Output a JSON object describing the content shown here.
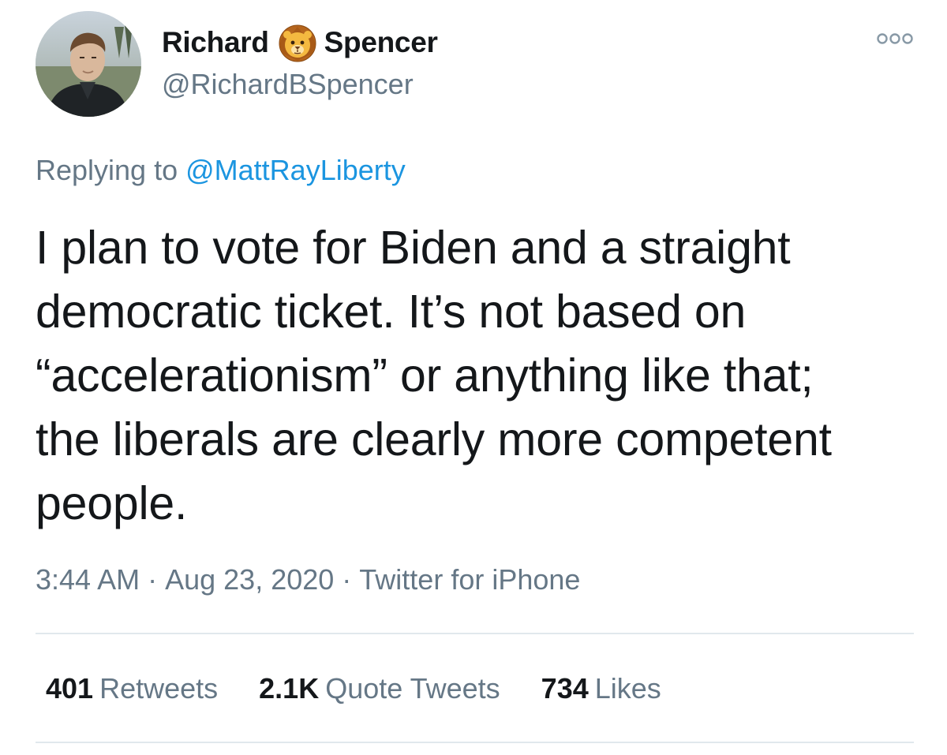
{
  "author": {
    "first_name": "Richard",
    "last_name": "Spencer",
    "name_icon": "lion-face-icon",
    "handle": "@RichardBSpencer",
    "avatar_icon": "profile-photo"
  },
  "menu": {
    "icon": "more-options-icon"
  },
  "reply": {
    "prefix": "Replying to",
    "to_handle": "@MattRayLiberty"
  },
  "tweet": {
    "text": "I plan to vote for Biden and a straight\ndemocratic ticket. It’s not based on\n“accelerationism” or anything like that;\nthe liberals are clearly more competent\npeople."
  },
  "meta": {
    "time": "3:44 AM",
    "separator": "·",
    "date": "Aug 23, 2020",
    "source": "Twitter for iPhone"
  },
  "stats": [
    {
      "count": "401",
      "label": "Retweets"
    },
    {
      "count": "2.1K",
      "label": "Quote Tweets"
    },
    {
      "count": "734",
      "label": "Likes"
    }
  ],
  "colors": {
    "text_primary": "#14171a",
    "text_secondary": "#657786",
    "link": "#1b95e0",
    "divider": "#e1e8ed"
  }
}
